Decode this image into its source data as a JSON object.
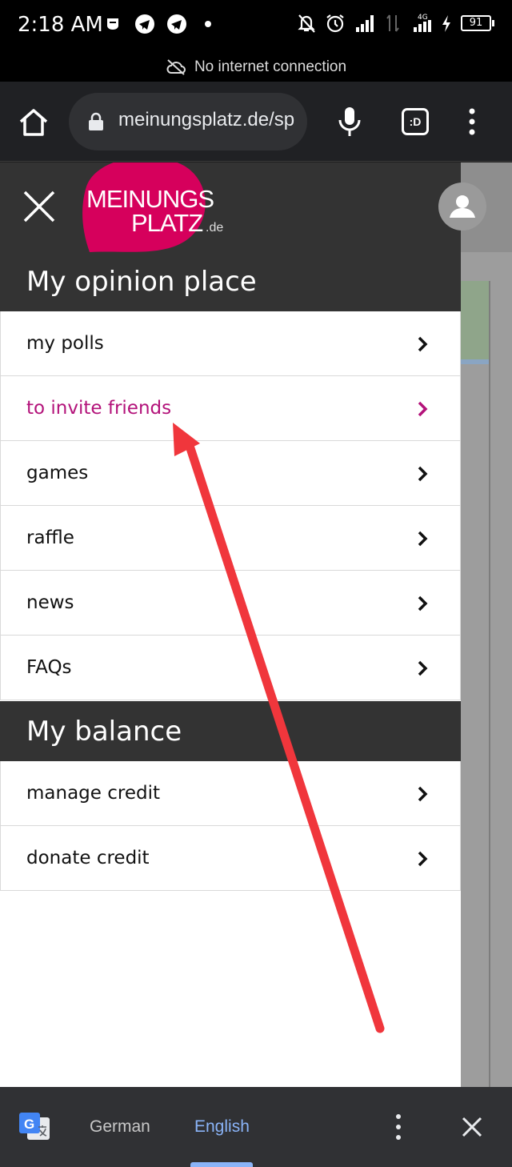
{
  "status_bar": {
    "time": "2:18 AM",
    "battery": "91",
    "network": "4G"
  },
  "network_banner": {
    "text": "No internet connection",
    "icon": "cloud-off-icon"
  },
  "browser": {
    "url": "meinungsplatz.de/sp",
    "tabs_label": ":D",
    "icons": [
      "home-icon",
      "lock-icon",
      "mic-icon",
      "tabs-icon",
      "more-vert-icon"
    ]
  },
  "drawer": {
    "logo": {
      "line1": "MEINUNGS",
      "line2": "PLATZ",
      "suffix": ".de"
    },
    "sections": [
      {
        "title": "My opinion place",
        "items": [
          {
            "label": "my polls",
            "active": false
          },
          {
            "label": "to invite friends",
            "active": true
          },
          {
            "label": "games",
            "active": false
          },
          {
            "label": "raffle",
            "active": false
          },
          {
            "label": "news",
            "active": false
          },
          {
            "label": "FAQs",
            "active": false
          }
        ]
      },
      {
        "title": "My balance",
        "items": [
          {
            "label": "manage credit",
            "active": false
          },
          {
            "label": "donate credit",
            "active": false
          }
        ]
      }
    ]
  },
  "translate_bar": {
    "source_lang": "German",
    "target_lang": "English",
    "selected": "English"
  },
  "colors": {
    "accent": "#b3127a",
    "logo_bg": "#d6005c",
    "header_bg": "#333333",
    "annotation_arrow": "#f0363c",
    "translate_selected": "#8ab4f8"
  }
}
